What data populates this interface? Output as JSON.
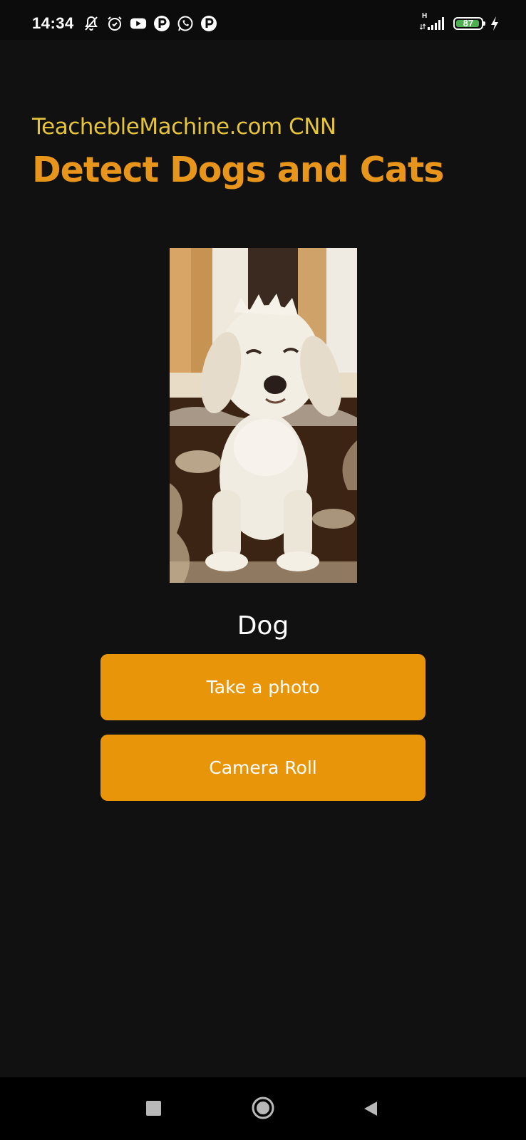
{
  "status_bar": {
    "time": "14:34",
    "battery_level": "87",
    "network_type": "H",
    "left_icons": [
      "muted-bell-icon",
      "alarm-icon",
      "youtube-icon",
      "p-app-icon",
      "whatsapp-icon",
      "p-app-icon"
    ],
    "right_icons": [
      "signal-icon",
      "battery-icon",
      "charging-icon"
    ]
  },
  "header": {
    "subtitle": "TeachebleMachine.com CNN",
    "title": "Detect Dogs and Cats"
  },
  "result": {
    "prediction": "Dog"
  },
  "buttons": {
    "take_photo": "Take a photo",
    "camera_roll": "Camera Roll"
  },
  "colors": {
    "background": "#111111",
    "subtitle": "#e5c43a",
    "title": "#e8951c",
    "button": "#e8950a",
    "battery": "#4caf50"
  },
  "nav_bar": {
    "icons": [
      "recents-square-icon",
      "home-circle-icon",
      "back-triangle-icon"
    ]
  }
}
